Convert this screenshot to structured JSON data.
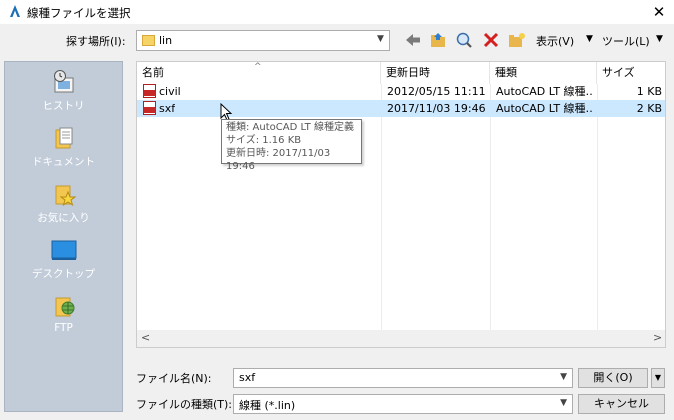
{
  "window": {
    "title": "線種ファイルを選択",
    "close_glyph": "✕"
  },
  "toolbar": {
    "lookin_label": "探す場所(I):",
    "lookin_value": "lin",
    "view_label": "表示(V)",
    "tools_label": "ツール(L)"
  },
  "places": [
    "ヒストリ",
    "ドキュメント",
    "お気に入り",
    "デスクトップ",
    "FTP"
  ],
  "columns": [
    "名前",
    "更新日時",
    "種類",
    "サイズ"
  ],
  "files": [
    {
      "name": "civil",
      "modified": "2012/05/15 11:11",
      "type": "AutoCAD LT 線種…",
      "size": "1 KB",
      "selected": false
    },
    {
      "name": "sxf",
      "modified": "2017/11/03 19:46",
      "type": "AutoCAD LT 線種…",
      "size": "2 KB",
      "selected": true
    }
  ],
  "tooltip": {
    "line1": "種類: AutoCAD LT 線種定義",
    "line2": "サイズ: 1.16 KB",
    "line3": "更新日時: 2017/11/03 19:46"
  },
  "filename": {
    "label": "ファイル名(N):",
    "value": "sxf"
  },
  "filetype": {
    "label": "ファイルの種類(T):",
    "value": "線種 (*.lin)"
  },
  "buttons": {
    "open": "開く(O)",
    "cancel": "キャンセル"
  },
  "colors": {
    "places_bg": "#c2ccd9",
    "selection": "#cce8ff",
    "accent": "#0078d7"
  }
}
